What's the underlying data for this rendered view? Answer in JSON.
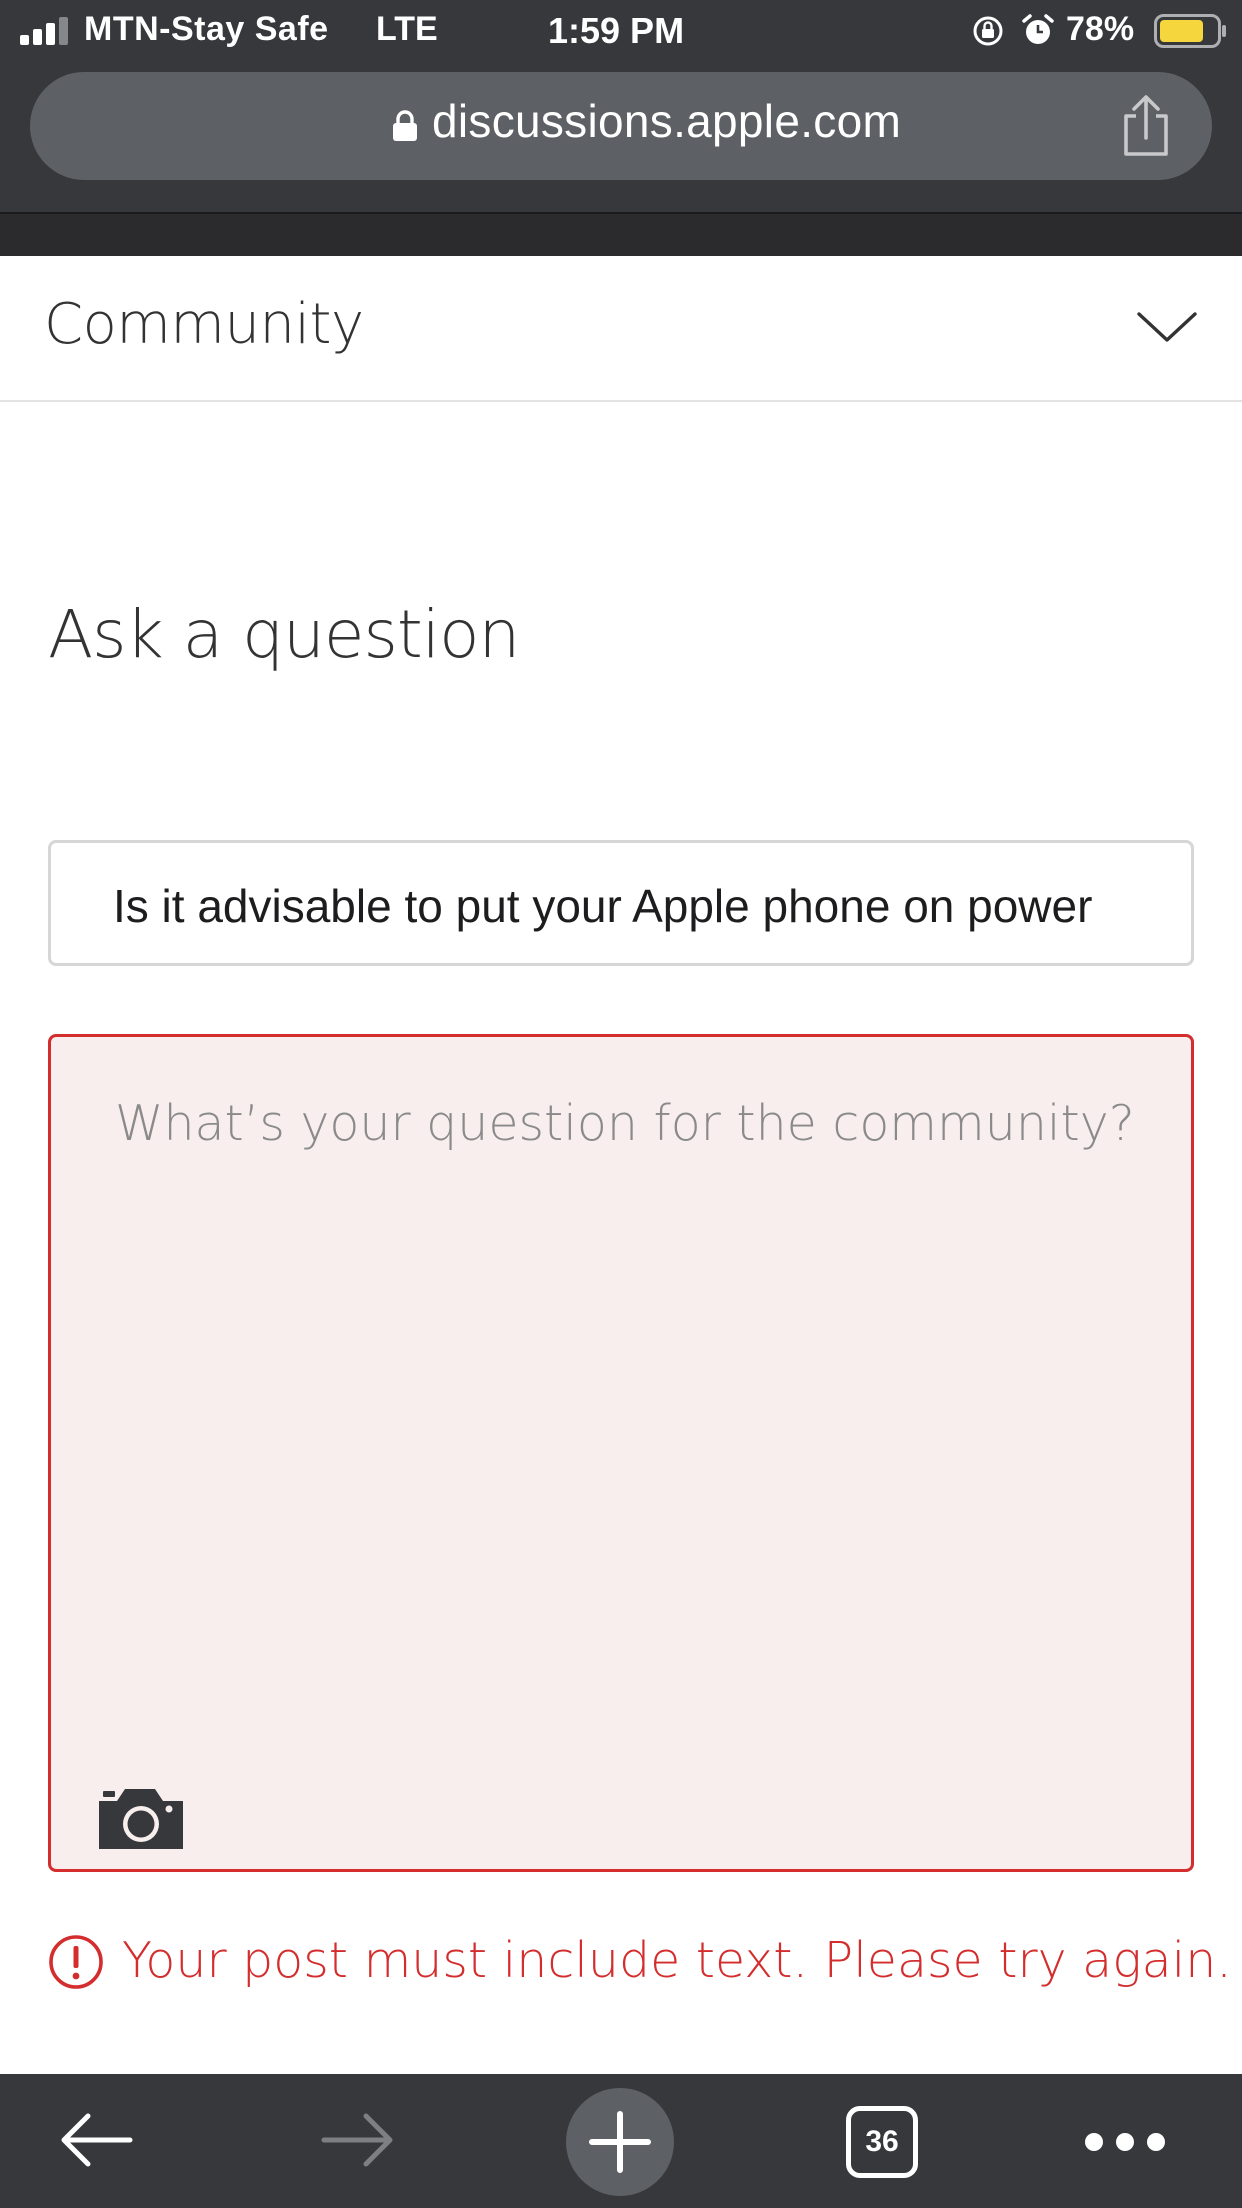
{
  "status_bar": {
    "carrier": "MTN-Stay Safe",
    "network": "LTE",
    "time": "1:59 PM",
    "battery_percent": "78%",
    "battery_level": 0.78,
    "battery_color": "#f5d63d"
  },
  "browser": {
    "url": "discussions.apple.com",
    "tab_count": "36",
    "icons": [
      "lock-icon",
      "share-icon",
      "back-icon",
      "forward-icon",
      "plus-icon",
      "more-icon"
    ]
  },
  "header": {
    "community_label": "Community"
  },
  "main": {
    "title": "Ask a question",
    "subject_value": "Is it advisable to put your Apple phone on power",
    "body_placeholder": "What’s your question for the community?",
    "error_message": "Your post must include text. Please try again."
  },
  "colors": {
    "error": "#d32d2d",
    "error_bg": "#f8eeee",
    "chrome": "#36383c"
  }
}
